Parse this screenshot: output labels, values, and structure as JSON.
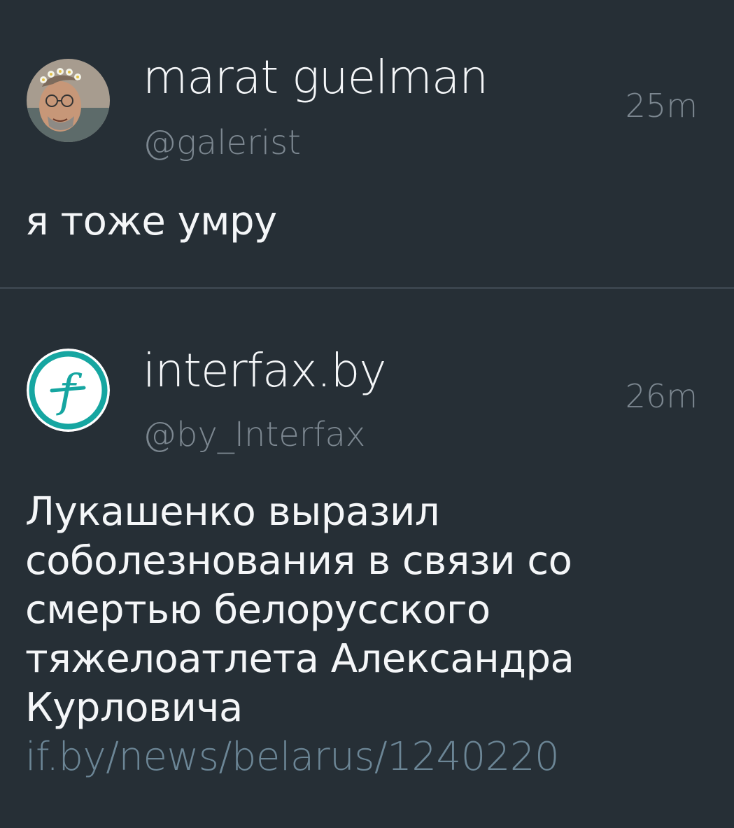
{
  "timeline": {
    "tweets": [
      {
        "display_name": "marat guelman",
        "handle": "@galerist",
        "time": "25m",
        "text": "я тоже умру",
        "avatar_icon": "user-photo-with-flower-wreath"
      },
      {
        "display_name": "interfax.by",
        "handle": "@by_Interfax",
        "time": "26m",
        "text": "Лукашенко выразил соболезнования в связи со смертью белорусского тяжелоатлета Александра Курловича",
        "link_text": "if.by/news/belarus/1240220",
        "avatar_icon": "interfax-logo-icon"
      }
    ]
  },
  "colors": {
    "background": "#262f36",
    "divider": "#3b454e",
    "secondary_text": "#7c8790",
    "link": "#6c8696",
    "interfax_teal": "#16a6a1"
  }
}
